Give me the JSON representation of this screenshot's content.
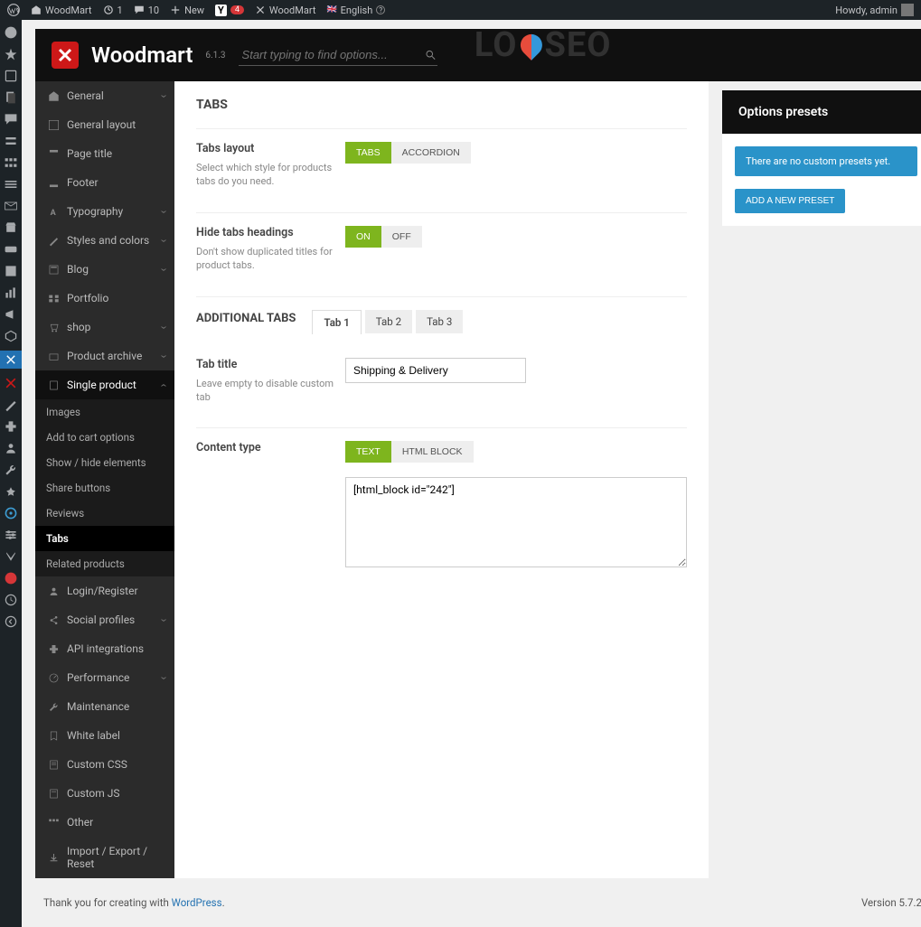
{
  "admin_bar": {
    "site_name": "WoodMart",
    "updates": "1",
    "comments": "10",
    "new": "New",
    "yoast_badge": "4",
    "theme": "WoodMart",
    "lang": "English",
    "howdy": "Howdy, admin"
  },
  "watermark": "LO    SEO",
  "theme": {
    "name": "Woodmart",
    "version": "6.1.3",
    "search_placeholder": "Start typing to find options..."
  },
  "nav": {
    "items": [
      {
        "label": "General",
        "sub": true
      },
      {
        "label": "General layout"
      },
      {
        "label": "Page title"
      },
      {
        "label": "Footer"
      },
      {
        "label": "Typography",
        "sub": true
      },
      {
        "label": "Styles and colors",
        "sub": true
      },
      {
        "label": "Blog",
        "sub": true
      },
      {
        "label": "Portfolio"
      },
      {
        "label": "shop",
        "sub": true
      },
      {
        "label": "Product archive",
        "sub": true
      },
      {
        "label": "Single product",
        "sub": true,
        "active": true
      },
      {
        "label": "Login/Register"
      },
      {
        "label": "Social profiles",
        "sub": true
      },
      {
        "label": "API integrations"
      },
      {
        "label": "Performance",
        "sub": true
      },
      {
        "label": "Maintenance"
      },
      {
        "label": "White label"
      },
      {
        "label": "Custom CSS"
      },
      {
        "label": "Custom JS"
      },
      {
        "label": "Other"
      },
      {
        "label": "Import / Export / Reset"
      }
    ],
    "sub_single_product": [
      {
        "label": "Images"
      },
      {
        "label": "Add to cart options"
      },
      {
        "label": "Show / hide elements"
      },
      {
        "label": "Share buttons"
      },
      {
        "label": "Reviews"
      },
      {
        "label": "Tabs",
        "active": true
      },
      {
        "label": "Related products"
      }
    ]
  },
  "page": {
    "title": "TABS",
    "tabs_layout": {
      "label": "Tabs layout",
      "desc": "Select which style for products tabs do you need.",
      "options": [
        "TABS",
        "ACCORDION"
      ],
      "active": 0
    },
    "hide_headings": {
      "label": "Hide tabs headings",
      "desc": "Don't show duplicated titles for product tabs.",
      "options": [
        "ON",
        "OFF"
      ],
      "active": 0
    },
    "additional_title": "ADDITIONAL TABS",
    "additional_tabs": [
      "Tab 1",
      "Tab 2",
      "Tab 3"
    ],
    "additional_active": 0,
    "tab_title": {
      "label": "Tab title",
      "desc": "Leave empty to disable custom tab",
      "value": "Shipping & Delivery"
    },
    "content_type": {
      "label": "Content type",
      "options": [
        "TEXT",
        "HTML BLOCK"
      ],
      "active": 0,
      "textarea": "[html_block id=\"242\"]"
    }
  },
  "presets": {
    "title": "Options presets",
    "empty": "There are no custom presets yet.",
    "button": "ADD A NEW PRESET"
  },
  "footer": {
    "thanks": "Thank you for creating with ",
    "wp": "WordPress",
    "version": "Version 5.7.2"
  }
}
